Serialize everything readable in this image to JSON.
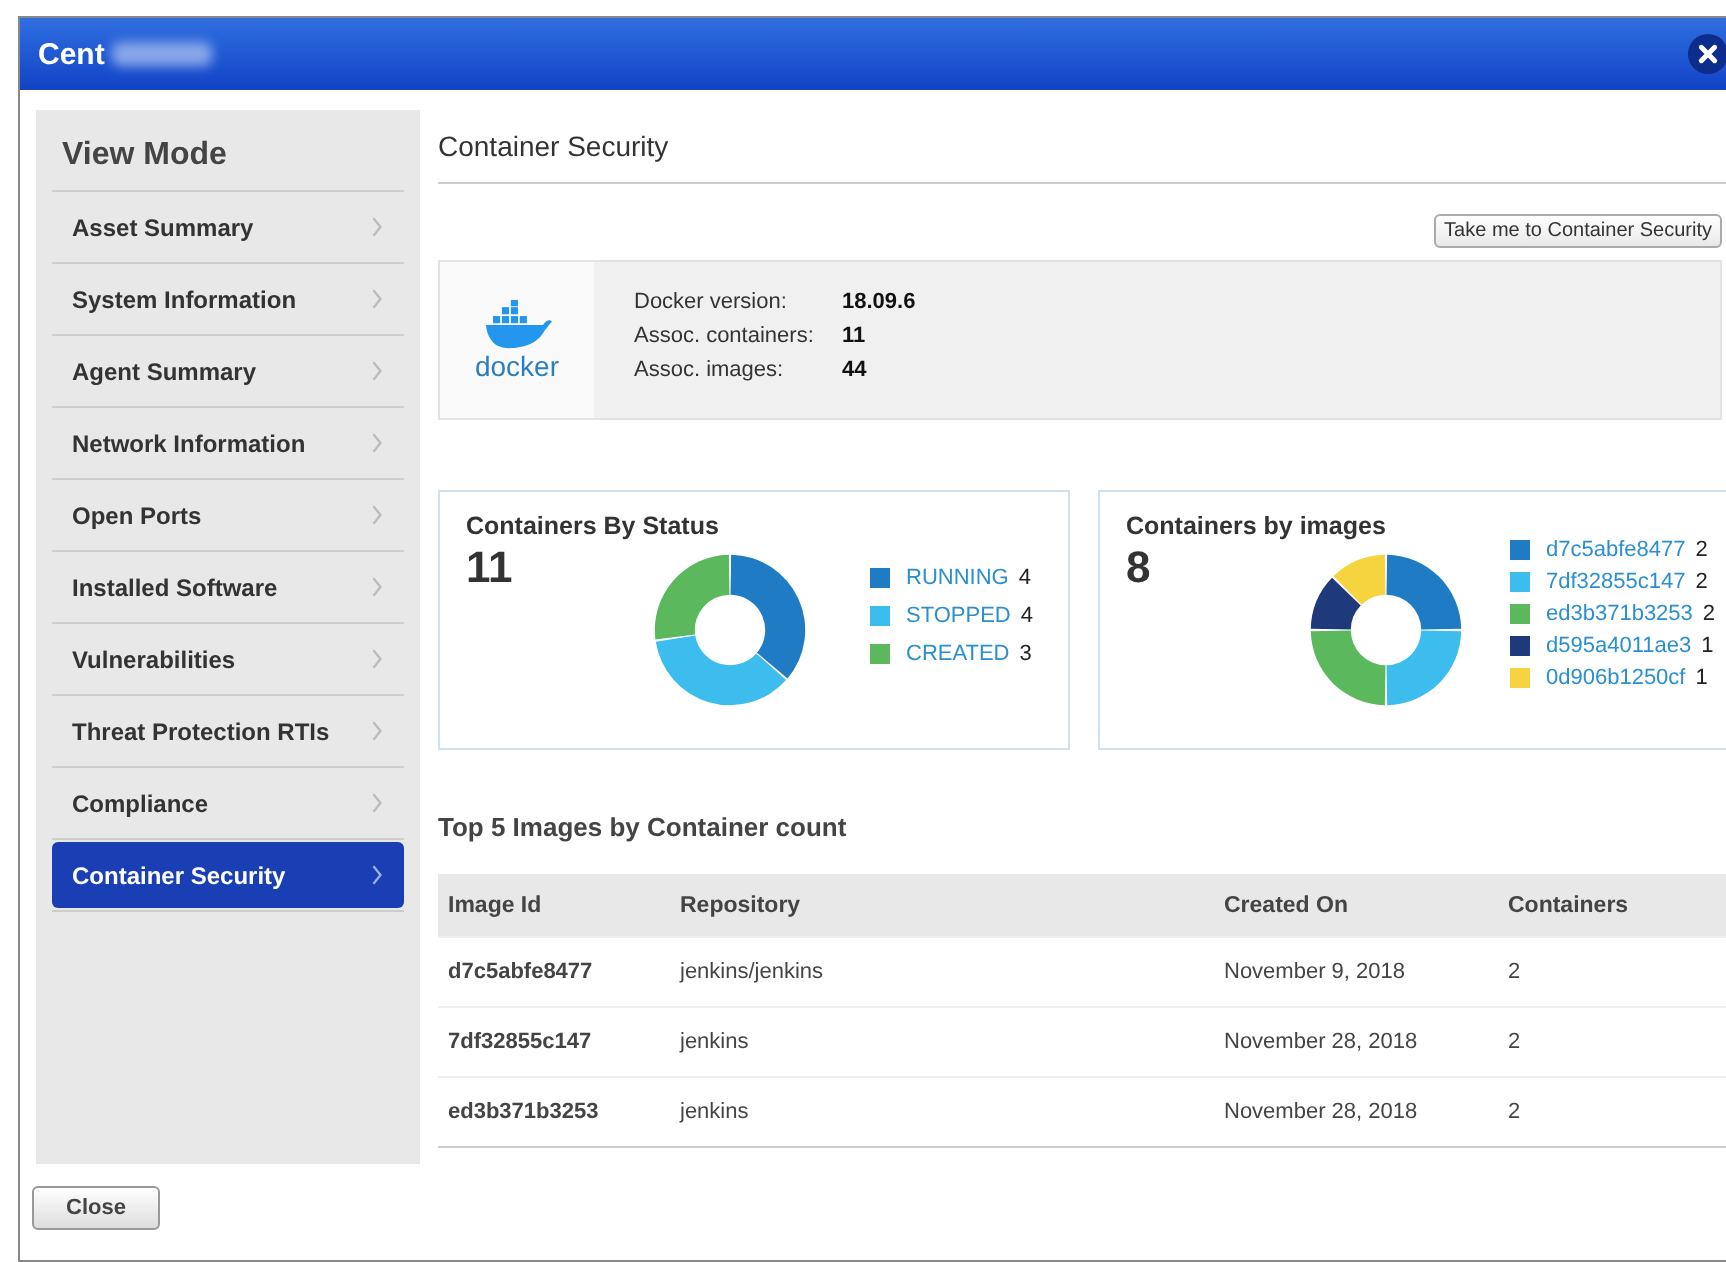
{
  "window": {
    "title": "Cent"
  },
  "sidebar": {
    "title": "View Mode",
    "items": [
      {
        "label": "Asset Summary",
        "selected": false
      },
      {
        "label": "System Information",
        "selected": false
      },
      {
        "label": "Agent Summary",
        "selected": false
      },
      {
        "label": "Network Information",
        "selected": false
      },
      {
        "label": "Open Ports",
        "selected": false
      },
      {
        "label": "Installed Software",
        "selected": false
      },
      {
        "label": "Vulnerabilities",
        "selected": false
      },
      {
        "label": "Threat Protection RTIs",
        "selected": false
      },
      {
        "label": "Compliance",
        "selected": false
      },
      {
        "label": "Container Security",
        "selected": true
      }
    ]
  },
  "content": {
    "title": "Container Security",
    "action_button": "Take me to Container Security",
    "docker": {
      "logo_text": "docker",
      "fields": [
        {
          "label": "Docker version:",
          "value": "18.09.6"
        },
        {
          "label": "Assoc. containers:",
          "value": "11"
        },
        {
          "label": "Assoc. images:",
          "value": "44"
        }
      ]
    },
    "cards": [
      {
        "title": "Containers By Status",
        "total": "11",
        "legend": [
          {
            "label": "RUNNING",
            "count": "4",
            "color": "#1f7bc4"
          },
          {
            "label": "STOPPED",
            "count": "4",
            "color": "#3dbdee"
          },
          {
            "label": "CREATED",
            "count": "3",
            "color": "#5cb85c"
          }
        ]
      },
      {
        "title": "Containers by images",
        "total": "8",
        "legend": [
          {
            "label": "d7c5abfe8477",
            "count": "2",
            "color": "#1f7bc4"
          },
          {
            "label": "7df32855c147",
            "count": "2",
            "color": "#3dbdee"
          },
          {
            "label": "ed3b371b3253",
            "count": "2",
            "color": "#5cb85c"
          },
          {
            "label": "d595a4011ae3",
            "count": "1",
            "color": "#1e3a7a"
          },
          {
            "label": "0d906b1250cf",
            "count": "1",
            "color": "#f5d43f"
          }
        ]
      }
    ],
    "table": {
      "title": "Top 5 Images by Container count",
      "columns": [
        "Image Id",
        "Repository",
        "Created On",
        "Containers"
      ],
      "rows": [
        [
          "d7c5abfe8477",
          "jenkins/jenkins",
          "November 9, 2018",
          "2"
        ],
        [
          "7df32855c147",
          "jenkins",
          "November 28, 2018",
          "2"
        ],
        [
          "ed3b371b3253",
          "jenkins",
          "November 28, 2018",
          "2"
        ]
      ]
    }
  },
  "footer": {
    "close_button": "Close"
  }
}
